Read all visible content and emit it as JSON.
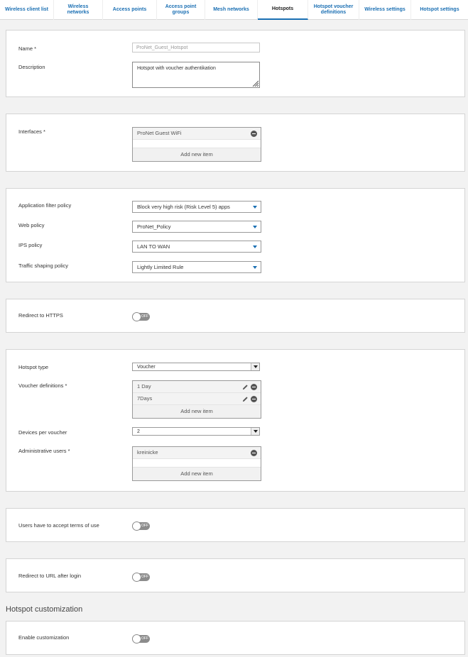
{
  "tabs": [
    {
      "label": "Wireless client list"
    },
    {
      "label": "Wireless networks"
    },
    {
      "label": "Access points"
    },
    {
      "label": "Access point groups"
    },
    {
      "label": "Mesh networks"
    },
    {
      "label": "Hotspots"
    },
    {
      "label": "Hotspot voucher definitions"
    },
    {
      "label": "Wireless settings"
    },
    {
      "label": "Hotspot settings"
    }
  ],
  "general": {
    "name_label": "Name *",
    "name_placeholder": "ProNet_Guest_Hotspot",
    "description_label": "Description",
    "description_value": "Hotspot with voucher authentikation"
  },
  "interfaces": {
    "label": "Interfaces *",
    "items": [
      "ProNet Guest WiFi"
    ],
    "add_label": "Add new item"
  },
  "policies": {
    "app_filter_label": "Application filter policy",
    "app_filter_value": "Block very high risk (Risk Level 5) apps",
    "web_label": "Web policy",
    "web_value": "ProNet_Policy",
    "ips_label": "IPS policy",
    "ips_value": "LAN TO WAN",
    "traffic_label": "Traffic shaping policy",
    "traffic_value": "Lightly Limited Rule"
  },
  "redirect_https": {
    "label": "Redirect to HTTPS",
    "state": "OFF"
  },
  "hotspot": {
    "type_label": "Hotspot type",
    "type_value": "Voucher",
    "voucher_label": "Voucher definitions *",
    "voucher_items": [
      "1 Day",
      "7Days"
    ],
    "voucher_add": "Add new item",
    "devices_label": "Devices per voucher",
    "devices_value": "2",
    "admin_label": "Administrative users *",
    "admin_items": [
      "kreinicke"
    ],
    "admin_add": "Add new item"
  },
  "terms": {
    "label": "Users have to accept terms of use",
    "state": "OFF"
  },
  "redirect_url": {
    "label": "Redirect to URL after login",
    "state": "OFF"
  },
  "customization": {
    "heading": "Hotspot customization",
    "enable_label": "Enable customization",
    "state": "OFF"
  },
  "colors": {
    "accent": "#1a6fb3",
    "toggle_off": "#8c8c8c"
  }
}
